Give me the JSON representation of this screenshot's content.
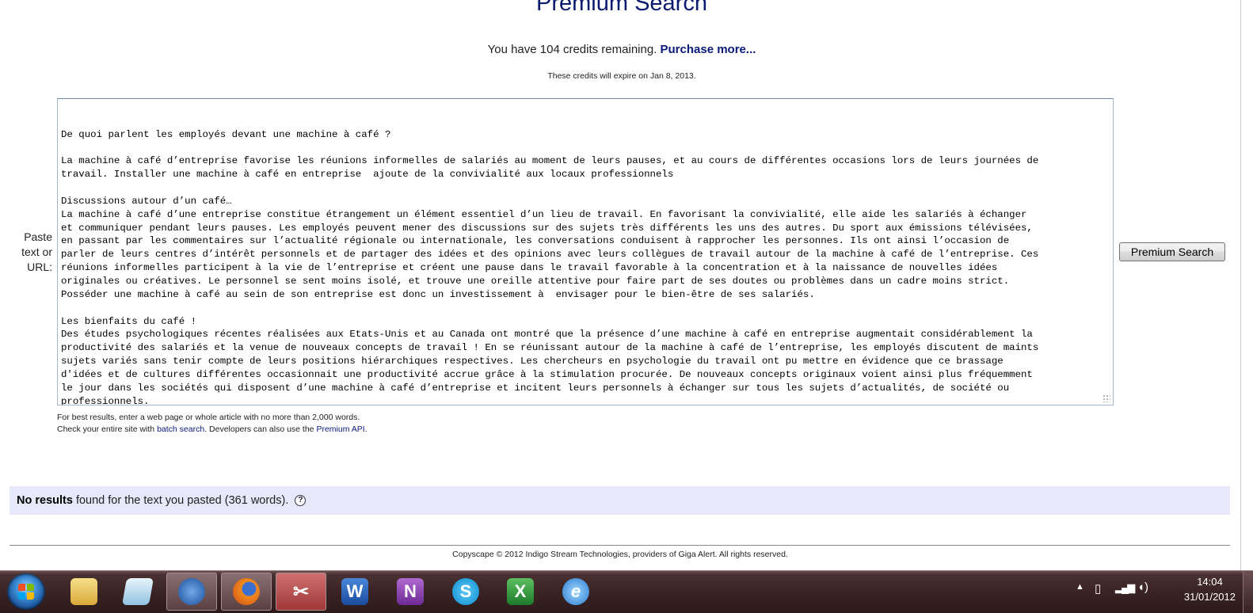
{
  "header": {
    "title": "Premium Search",
    "credits_prefix": "You have 104 credits remaining.",
    "purchase_link": "Purchase more...",
    "expire_note": "These credits will expire on Jan 8, 2013."
  },
  "form": {
    "paste_label_1": "Paste",
    "paste_label_2": "text or",
    "paste_label_3": "URL:",
    "text_lines": [
      "De quoi parlent les employés devant une machine à café ?",
      "",
      "La machine à café d’entreprise favorise les réunions informelles de salariés au moment de leurs pauses, et au cours de différentes occasions lors de leurs journées de",
      "travail. Installer une machine à café en entreprise  ajoute de la convivialité aux locaux professionnels",
      "",
      "Discussions autour d’un café…",
      "La machine à café d’une entreprise constitue étrangement un élément essentiel d’un lieu de travail. En favorisant la convivialité, elle aide les salariés à échanger",
      "et communiquer pendant leurs pauses. Les employés peuvent mener des discussions sur des sujets très différents les uns des autres. Du sport aux émissions télévisées,",
      "en passant par les commentaires sur l’actualité régionale ou internationale, les conversations conduisent à rapprocher les personnes. Ils ont ainsi l’occasion de",
      "parler de leurs centres d’intérêt personnels et de partager des idées et des opinions avec leurs collègues de travail autour de la machine à café de l’entreprise. Ces",
      "réunions informelles participent à la vie de l’entreprise et créent une pause dans le travail favorable à la concentration et à la naissance de nouvelles idées",
      "originales ou créatives. Le personnel se sent moins isolé, et trouve une oreille attentive pour faire part de ses doutes ou problèmes dans un cadre moins strict.",
      "Posséder une machine à café au sein de son entreprise est donc un investissement à  envisager pour le bien-être de ses salariés.",
      "",
      "Les bienfaits du café !",
      "Des études psychologiques récentes réalisées aux Etats-Unis et au Canada ont montré que la présence d’une machine à café en entreprise augmentait considérablement la",
      "productivité des salariés et la venue de nouveaux concepts de travail ! En se réunissant autour de la machine à café de l’entreprise, les employés discutent de maints",
      "sujets variés sans tenir compte de leurs positions hiérarchiques respectives. Les chercheurs en psychologie du travail ont pu mettre en évidence que ce brassage",
      "d'idées et de cultures différentes occasionnait une productivité accrue grâce à la stimulation procurée. De nouveaux concepts originaux voient ainsi plus fréquemment",
      "le jour dans les sociétés qui disposent d’une machine à café d’entreprise et incitent leurs personnels à échanger sur tous les sujets d’actualités, de société ou",
      "professionnels."
    ],
    "search_button": "Premium Search",
    "hint_line1": "For best results, enter a web page or whole article with no more than 2,000 words.",
    "hint_line2_prefix": "Check your entire site with ",
    "batch_link": "batch search",
    "hint_line2_middle": ". Developers can also use the ",
    "api_link": "Premium API",
    "hint_line2_suffix": "."
  },
  "results": {
    "bold": "No results",
    "rest": " found for the text you pasted (361 words).",
    "help": "?"
  },
  "footer": {
    "text": "Copyscape © 2012 Indigo Stream Technologies, providers of Giga Alert. All rights reserved."
  },
  "taskbar": {
    "apps": [
      "explorer-icon",
      "notepad-icon",
      "thunderbird-icon",
      "firefox-icon",
      "snipping-tool-icon",
      "word-icon",
      "onenote-icon",
      "skype-icon",
      "excel-icon",
      "internet-explorer-icon"
    ],
    "time": "14:04",
    "date": "31/01/2012"
  }
}
